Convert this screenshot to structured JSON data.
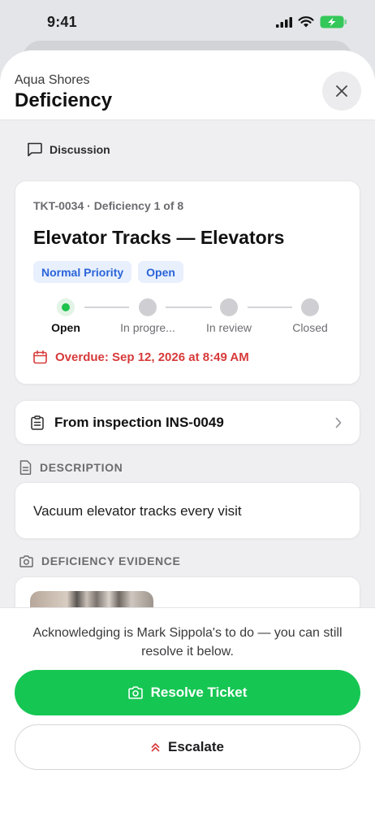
{
  "status_bar": {
    "time": "9:41"
  },
  "header": {
    "subtitle": "Aqua Shores",
    "title": "Deficiency"
  },
  "discussion": {
    "label": "Discussion"
  },
  "ticket": {
    "id_line": "TKT-0034 · Deficiency 1 of 8",
    "title": "Elevator Tracks — Elevators",
    "badges": [
      "Normal Priority",
      "Open"
    ],
    "steps": [
      "Open",
      "In progre...",
      "In review",
      "Closed"
    ],
    "active_step": 0,
    "overdue": "Overdue: Sep 12, 2026 at 8:49 AM"
  },
  "inspection": {
    "label": "From inspection INS-0049"
  },
  "description": {
    "heading": "DESCRIPTION",
    "text": "Vacuum elevator tracks every visit"
  },
  "evidence": {
    "heading": "DEFICIENCY EVIDENCE"
  },
  "footer": {
    "note": "Acknowledging is Mark Sippola's to do — you can still resolve it below.",
    "resolve_label": "Resolve Ticket",
    "escalate_label": "Escalate"
  },
  "colors": {
    "accent_green": "#16c653",
    "badge_blue": "#2a64d8",
    "overdue_red": "#d83a3a",
    "battery_green": "#34c759"
  }
}
